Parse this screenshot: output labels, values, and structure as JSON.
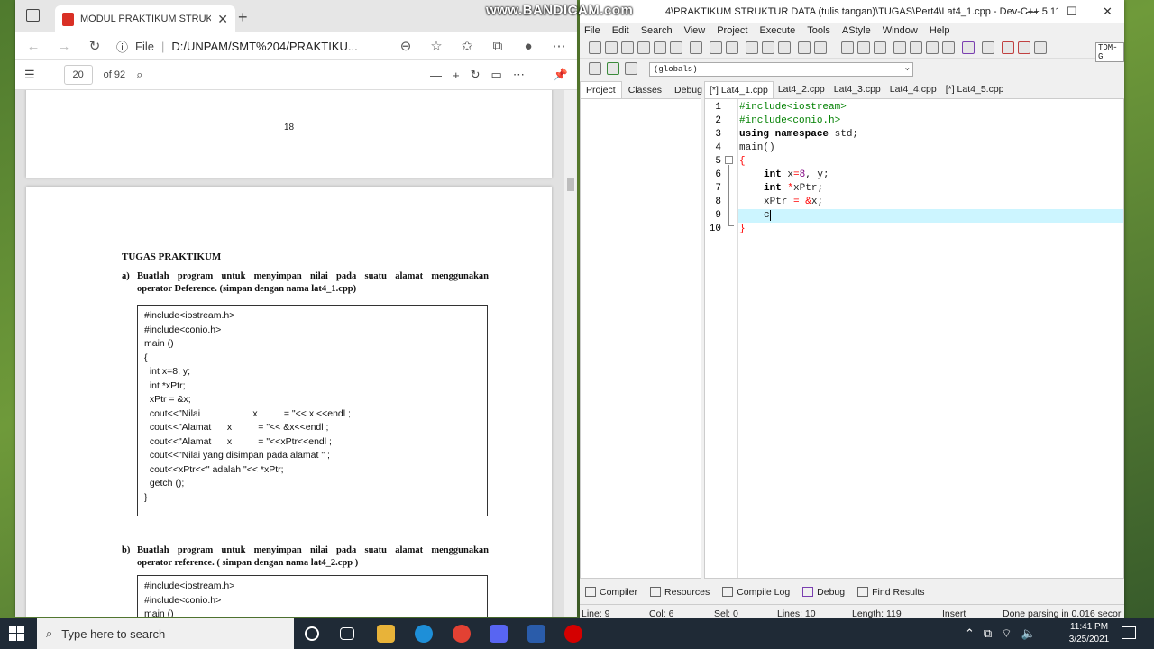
{
  "watermark": "www.BANDICAM.com",
  "browser": {
    "tab_title": "MODUL PRAKTIKUM STRUKTUR",
    "tab_close": "✕",
    "new_tab": "+",
    "address_label": "File",
    "url": "D:/UNPAM/SMT%204/PRAKTIKU...",
    "pdf_page": "20",
    "pdf_total": "of 92"
  },
  "pdf": {
    "page_number": "18",
    "heading": "TUGAS PRAKTIKUM",
    "task_a_marker": "a)",
    "task_a_line1": "Buatlah program untuk menyimpan nilai pada suatu alamat menggunakan",
    "task_a_line2": "operator Deference. (simpan dengan nama lat4_1.cpp)",
    "code_a": "#include<iostream.h>\n#include<conio.h>\nmain ()\n{\n  int x=8, y;\n  int *xPtr;\n  xPtr = &x;\n  cout<<\"Nilai                    x          = \"<< x <<endl ;\n  cout<<\"Alamat      x          = \"<< &x<<endl ;\n  cout<<\"Alamat      x          = \"<<xPtr<<endl ;\n  cout<<\"Nilai yang disimpan pada alamat \" ;\n  cout<<xPtr<<\" adalah \"<< *xPtr;\n  getch ();\n}",
    "task_b_marker": "b)",
    "task_b_line1": "Buatlah program untuk menyimpan nilai pada suatu alamat menggunakan",
    "task_b_line2": "operator reference. ( simpan dengan nama lat4_2.cpp )",
    "code_b": "#include<iostream.h>\n#include<conio.h>\nmain ()"
  },
  "devcpp": {
    "title": "4\\PRAKTIKUM STRUKTUR DATA (tulis tangan)\\TUGAS\\Pert4\\Lat4_1.cpp - Dev-C++ 5.11",
    "menu": [
      "File",
      "Edit",
      "Search",
      "View",
      "Project",
      "Execute",
      "Tools",
      "AStyle",
      "Window",
      "Help"
    ],
    "toolbar_label": "TDM-G",
    "globals": "(globals)",
    "panel_tabs": [
      "Project",
      "Classes",
      "Debug"
    ],
    "file_tabs": [
      "[*] Lat4_1.cpp",
      "Lat4_2.cpp",
      "Lat4_3.cpp",
      "Lat4_4.cpp",
      "[*] Lat4_5.cpp"
    ],
    "line_numbers": [
      "1",
      "2",
      "3",
      "4",
      "5",
      "6",
      "7",
      "8",
      "9",
      "10"
    ],
    "code": {
      "l1": "#include<iostream>",
      "l2": "#include<conio.h>",
      "l3_kw": "using namespace",
      "l3_rest": " std;",
      "l4": "main()",
      "l5": "{",
      "l6_kw": "int",
      "l6_a": " x",
      "l6_op": "=",
      "l6_num": "8",
      "l6_b": ", y;",
      "l7_kw": "int",
      "l7_op": " *",
      "l7_rest": "xPtr;",
      "l8_a": "xPtr ",
      "l8_op": "= &",
      "l8_rest": "x;",
      "l9": "c",
      "l10": "}"
    },
    "bottom_tabs": [
      "Compiler",
      "Resources",
      "Compile Log",
      "Debug",
      "Find Results"
    ],
    "status": {
      "line": "Line:    9",
      "col": "Col:    6",
      "sel": "Sel:    0",
      "lines": "Lines:    10",
      "length": "Length:   119",
      "mode": "Insert",
      "msg": "Done parsing in 0.016 secor"
    }
  },
  "taskbar": {
    "search_placeholder": "Type here to search",
    "time": "11:41 PM",
    "date": "3/25/2021"
  }
}
